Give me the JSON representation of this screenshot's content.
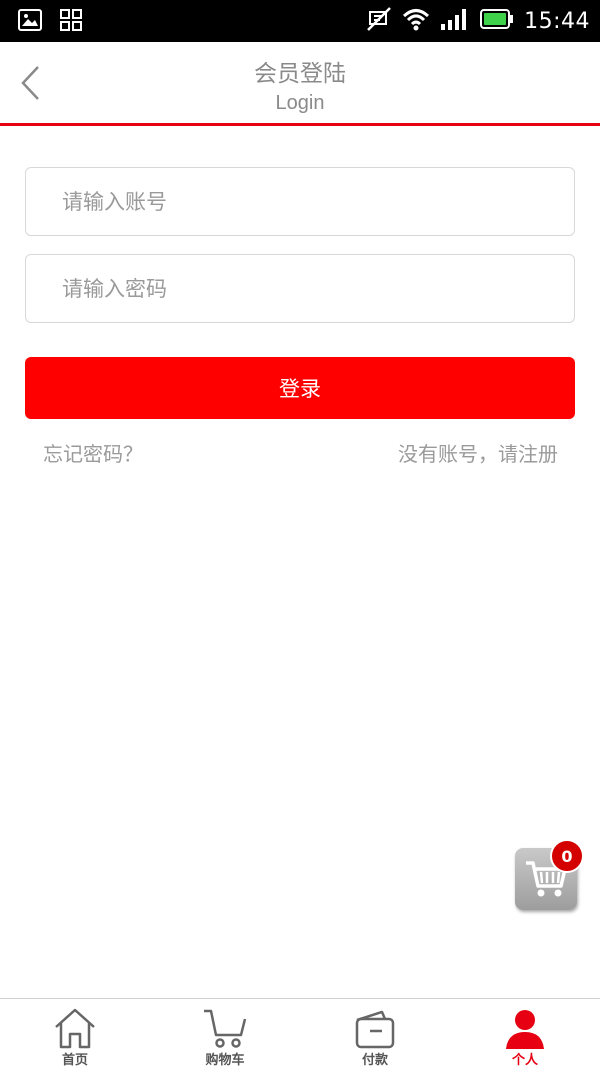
{
  "status_bar": {
    "time": "15:44",
    "icons": [
      "image-icon",
      "apps-icon",
      "mute-icon",
      "wifi-icon",
      "signal-icon",
      "battery-icon"
    ]
  },
  "header": {
    "title_zh": "会员登陆",
    "title_en": "Login",
    "back_icon": "chevron-left-icon",
    "accent_color": "#e60012"
  },
  "form": {
    "account_placeholder": "请输入账号",
    "account_value": "",
    "password_placeholder": "请输入密码",
    "password_value": "",
    "login_label": "登录",
    "login_color": "#ff0000",
    "forgot_label": "忘记密码？",
    "register_label": "没有账号，请注册"
  },
  "floating_cart": {
    "icon": "cart-icon",
    "count": "0"
  },
  "bottom_nav": {
    "items": [
      {
        "label": "首页",
        "icon": "home-icon",
        "active": false
      },
      {
        "label": "购物车",
        "icon": "cart-icon",
        "active": false
      },
      {
        "label": "付款",
        "icon": "wallet-icon",
        "active": false
      },
      {
        "label": "个人",
        "icon": "person-icon",
        "active": true
      }
    ]
  }
}
